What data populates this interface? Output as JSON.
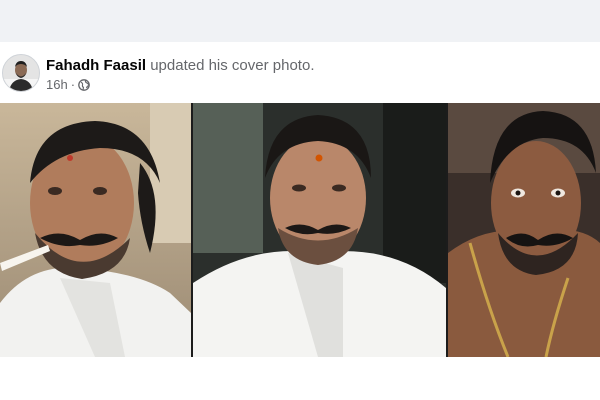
{
  "post": {
    "author": "Fahadh Faasil",
    "action": " updated his cover photo.",
    "timestamp": "16h",
    "separator": "·",
    "privacy_icon": "globe-icon",
    "avatar_icon": "profile-avatar"
  },
  "photos": [
    {
      "name": "cover-photo-left"
    },
    {
      "name": "cover-photo-center"
    },
    {
      "name": "cover-photo-right"
    }
  ],
  "colors": {
    "page_background": "#f0f2f5",
    "card_background": "#ffffff",
    "author_text": "#050505",
    "secondary_text": "#65676b"
  }
}
